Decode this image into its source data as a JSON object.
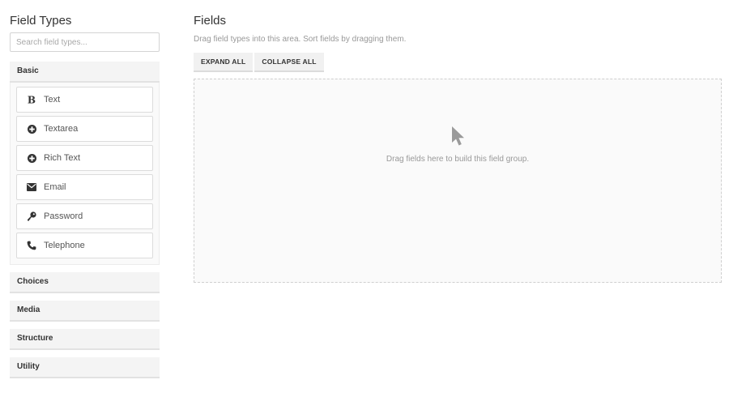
{
  "left": {
    "title": "Field Types",
    "search_placeholder": "Search field types...",
    "groups": [
      {
        "label": "Basic",
        "items": [
          {
            "label": "Text",
            "icon": "bold-icon"
          },
          {
            "label": "Textarea",
            "icon": "plus-circle-icon"
          },
          {
            "label": "Rich Text",
            "icon": "plus-circle-icon"
          },
          {
            "label": "Email",
            "icon": "envelope-icon"
          },
          {
            "label": "Password",
            "icon": "key-icon"
          },
          {
            "label": "Telephone",
            "icon": "phone-icon"
          }
        ]
      },
      {
        "label": "Choices"
      },
      {
        "label": "Media"
      },
      {
        "label": "Structure"
      },
      {
        "label": "Utility"
      }
    ]
  },
  "right": {
    "title": "Fields",
    "hint": "Drag field types into this area. Sort fields by dragging them.",
    "expand_label": "EXPAND ALL",
    "collapse_label": "COLLAPSE ALL",
    "drop_message": "Drag fields here to build this field group.",
    "drop_icon": "mouse-pointer-icon"
  }
}
